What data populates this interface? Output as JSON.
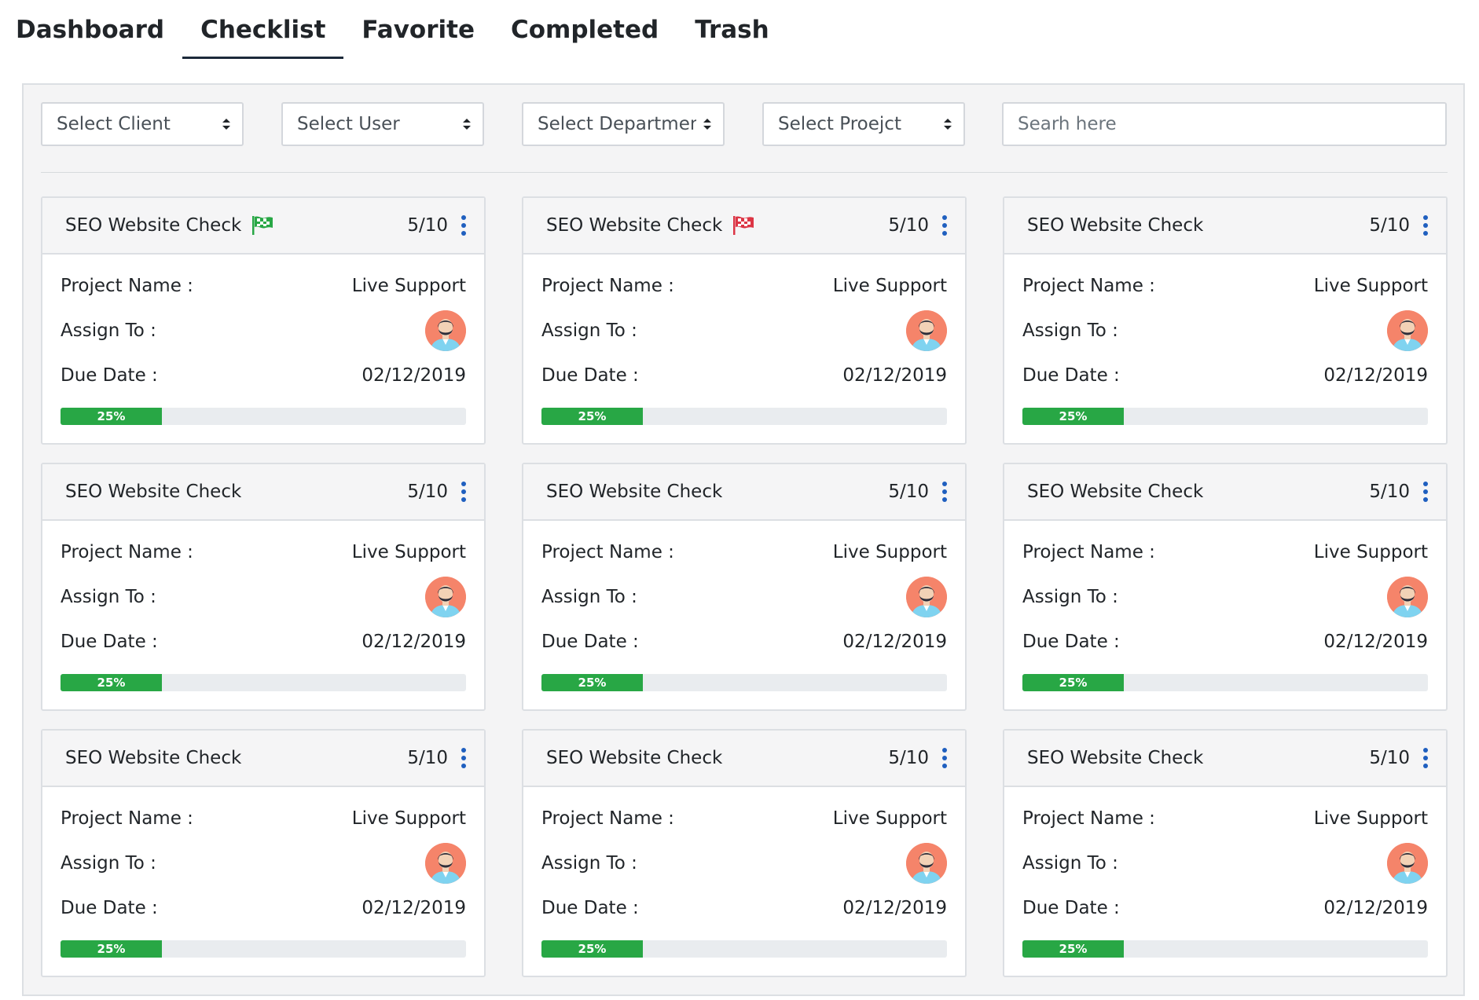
{
  "tabs": [
    {
      "label": "Dashboard",
      "active": false
    },
    {
      "label": "Checklist",
      "active": true
    },
    {
      "label": "Favorite",
      "active": false
    },
    {
      "label": "Completed",
      "active": false
    },
    {
      "label": "Trash",
      "active": false
    }
  ],
  "filters": {
    "client": "Select Client",
    "user": "Select User",
    "department": "Select Department",
    "project": "Select Proejct",
    "search_placeholder": "Searh here"
  },
  "labels": {
    "project_name": "Project Name :",
    "assign_to": "Assign To :",
    "due_date": "Due Date :"
  },
  "colors": {
    "progress_fill": "#28a745",
    "kebab": "#1f5fbf",
    "flag_green": "#28a745",
    "flag_red": "#dc3545",
    "tab_underline": "#1c2a3a"
  },
  "cards": [
    {
      "title": "SEO Website Check",
      "flag": "green",
      "count": "5/10",
      "project": "Live Support",
      "due": "02/12/2019",
      "progress": 25,
      "progress_label": "25%"
    },
    {
      "title": "SEO Website Check",
      "flag": "red",
      "count": "5/10",
      "project": "Live Support",
      "due": "02/12/2019",
      "progress": 25,
      "progress_label": "25%"
    },
    {
      "title": "SEO Website Check",
      "flag": "",
      "count": "5/10",
      "project": "Live Support",
      "due": "02/12/2019",
      "progress": 25,
      "progress_label": "25%"
    },
    {
      "title": "SEO Website Check",
      "flag": "",
      "count": "5/10",
      "project": "Live Support",
      "due": "02/12/2019",
      "progress": 25,
      "progress_label": "25%"
    },
    {
      "title": "SEO Website Check",
      "flag": "",
      "count": "5/10",
      "project": "Live Support",
      "due": "02/12/2019",
      "progress": 25,
      "progress_label": "25%"
    },
    {
      "title": "SEO Website Check",
      "flag": "",
      "count": "5/10",
      "project": "Live Support",
      "due": "02/12/2019",
      "progress": 25,
      "progress_label": "25%"
    },
    {
      "title": "SEO Website Check",
      "flag": "",
      "count": "5/10",
      "project": "Live Support",
      "due": "02/12/2019",
      "progress": 25,
      "progress_label": "25%"
    },
    {
      "title": "SEO Website Check",
      "flag": "",
      "count": "5/10",
      "project": "Live Support",
      "due": "02/12/2019",
      "progress": 25,
      "progress_label": "25%"
    },
    {
      "title": "SEO Website Check",
      "flag": "",
      "count": "5/10",
      "project": "Live Support",
      "due": "02/12/2019",
      "progress": 25,
      "progress_label": "25%"
    }
  ]
}
